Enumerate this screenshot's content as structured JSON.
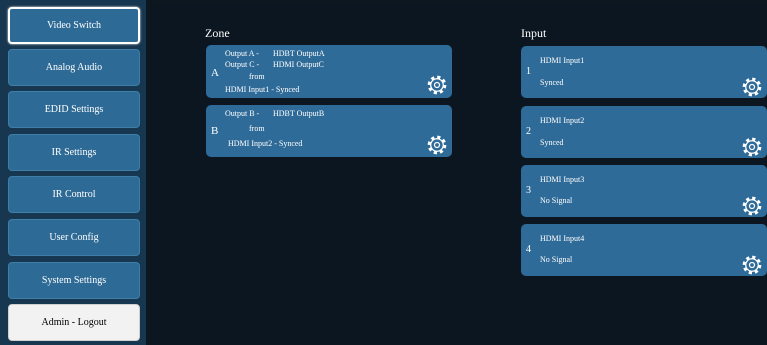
{
  "sidebar": {
    "items": [
      {
        "label": "Video Switch"
      },
      {
        "label": "Analog Audio"
      },
      {
        "label": "EDID Settings"
      },
      {
        "label": "IR Settings"
      },
      {
        "label": "IR Control"
      },
      {
        "label": "User Config"
      },
      {
        "label": "System Settings"
      },
      {
        "label": "Admin - Logout"
      }
    ]
  },
  "zone": {
    "heading": "Zone",
    "cards": [
      {
        "letter": "A",
        "line1_label": "Output A -",
        "line1_value": "HDBT OutputA",
        "line2_label": "Output C -",
        "line2_value": "HDMI OutputC",
        "from": "from",
        "source": "HDMI Input1 - Synced"
      },
      {
        "letter": "B",
        "line1_label": "Output B -",
        "line1_value": "HDBT OutputB",
        "from": "from",
        "source": "HDMI Input2 - Synced"
      }
    ]
  },
  "input": {
    "heading": "Input",
    "cards": [
      {
        "number": "1",
        "name": "HDMI Input1",
        "status": "Synced"
      },
      {
        "number": "2",
        "name": "HDMI Input2",
        "status": "Synced"
      },
      {
        "number": "3",
        "name": "HDMI Input3",
        "status": "No Signal"
      },
      {
        "number": "4",
        "name": "HDMI Input4",
        "status": "No Signal"
      }
    ]
  },
  "icons": {
    "settings": "gear-icon"
  },
  "colors": {
    "card": "#2f6b98",
    "sidebar": "#17364f",
    "background": "#0b1620"
  }
}
